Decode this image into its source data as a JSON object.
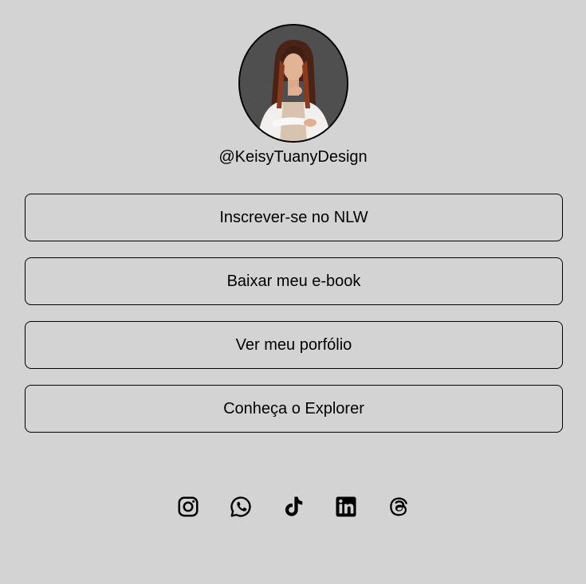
{
  "profile": {
    "handle": "@KeisyTuanyDesign",
    "avatar_alt": "profile photo"
  },
  "links": [
    {
      "label": "Inscrever-se no NLW"
    },
    {
      "label": "Baixar meu e-book"
    },
    {
      "label": "Ver meu porfólio"
    },
    {
      "label": "Conheça o Explorer"
    }
  ],
  "socials": [
    {
      "icon": "instagram-icon"
    },
    {
      "icon": "whatsapp-icon"
    },
    {
      "icon": "tiktok-icon"
    },
    {
      "icon": "linkedin-icon"
    },
    {
      "icon": "threads-icon"
    }
  ],
  "colors": {
    "background": "#d3d3d3",
    "border": "#000000",
    "text": "#000000"
  }
}
